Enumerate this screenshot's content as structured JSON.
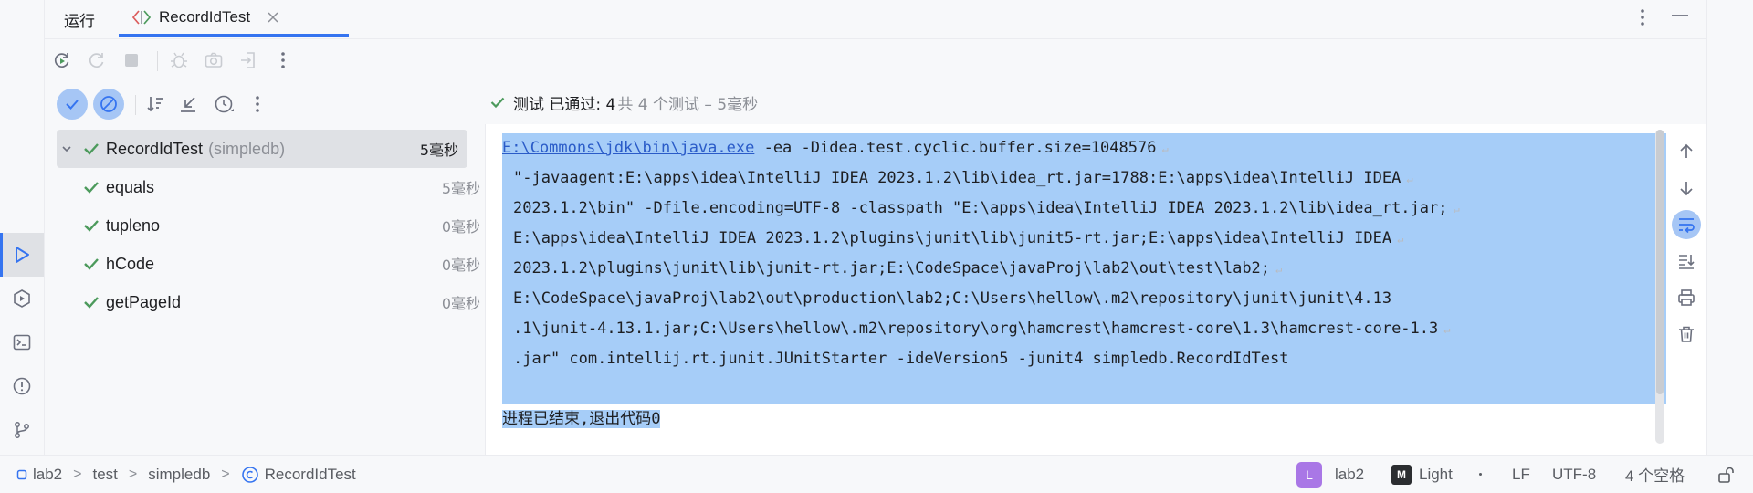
{
  "tool_window": {
    "title": "运行",
    "tab_label": "RecordIdTest"
  },
  "status": {
    "passed": "测试 已通过: 4",
    "total": "共 4 个测试 – 5毫秒"
  },
  "tree": {
    "root": {
      "name": "RecordIdTest",
      "hint": "(simpledb)",
      "time": "5毫秒"
    },
    "items": [
      {
        "name": "equals",
        "time": "5毫秒"
      },
      {
        "name": "tupleno",
        "time": "0毫秒"
      },
      {
        "name": "hCode",
        "time": "0毫秒"
      },
      {
        "name": "getPageId",
        "time": "0毫秒"
      }
    ]
  },
  "console": {
    "exe_link": "E:\\Commons\\jdk\\bin\\java.exe",
    "lines": [
      " -ea -Didea.test.cyclic.buffer.size=1048576",
      "\"-javaagent:E:\\apps\\idea\\IntelliJ IDEA 2023.1.2\\lib\\idea_rt.jar=1788:E:\\apps\\idea\\IntelliJ IDEA",
      "2023.1.2\\bin\" -Dfile.encoding=UTF-8 -classpath \"E:\\apps\\idea\\IntelliJ IDEA 2023.1.2\\lib\\idea_rt.jar;",
      "E:\\apps\\idea\\IntelliJ IDEA 2023.1.2\\plugins\\junit\\lib\\junit5-rt.jar;E:\\apps\\idea\\IntelliJ IDEA",
      "2023.1.2\\plugins\\junit\\lib\\junit-rt.jar;E:\\CodeSpace\\javaProj\\lab2\\out\\test\\lab2;",
      "E:\\CodeSpace\\javaProj\\lab2\\out\\production\\lab2;C:\\Users\\hellow\\.m2\\repository\\junit\\junit\\4.13",
      ".1\\junit-4.13.1.jar;C:\\Users\\hellow\\.m2\\repository\\org\\hamcrest\\hamcrest-core\\1.3\\hamcrest-core-1.3",
      ".jar\" com.intellij.rt.junit.JUnitStarter -ideVersion5 -junit4 simpledb.RecordIdTest"
    ],
    "exit_message": "进程已结束,退出代码0"
  },
  "status_bar": {
    "breadcrumb": [
      "lab2",
      "test",
      "simpledb",
      "RecordIdTest"
    ],
    "project_badge": "L",
    "project": "lab2",
    "theme_badge": "M",
    "theme": "Light",
    "line_ending": "LF",
    "encoding": "UTF-8",
    "indent": "4 个空格"
  },
  "colors": {
    "accent": "#3574f0",
    "success": "#4c9a5c",
    "selection": "#a6cdf8",
    "link": "#2a5bc8"
  }
}
